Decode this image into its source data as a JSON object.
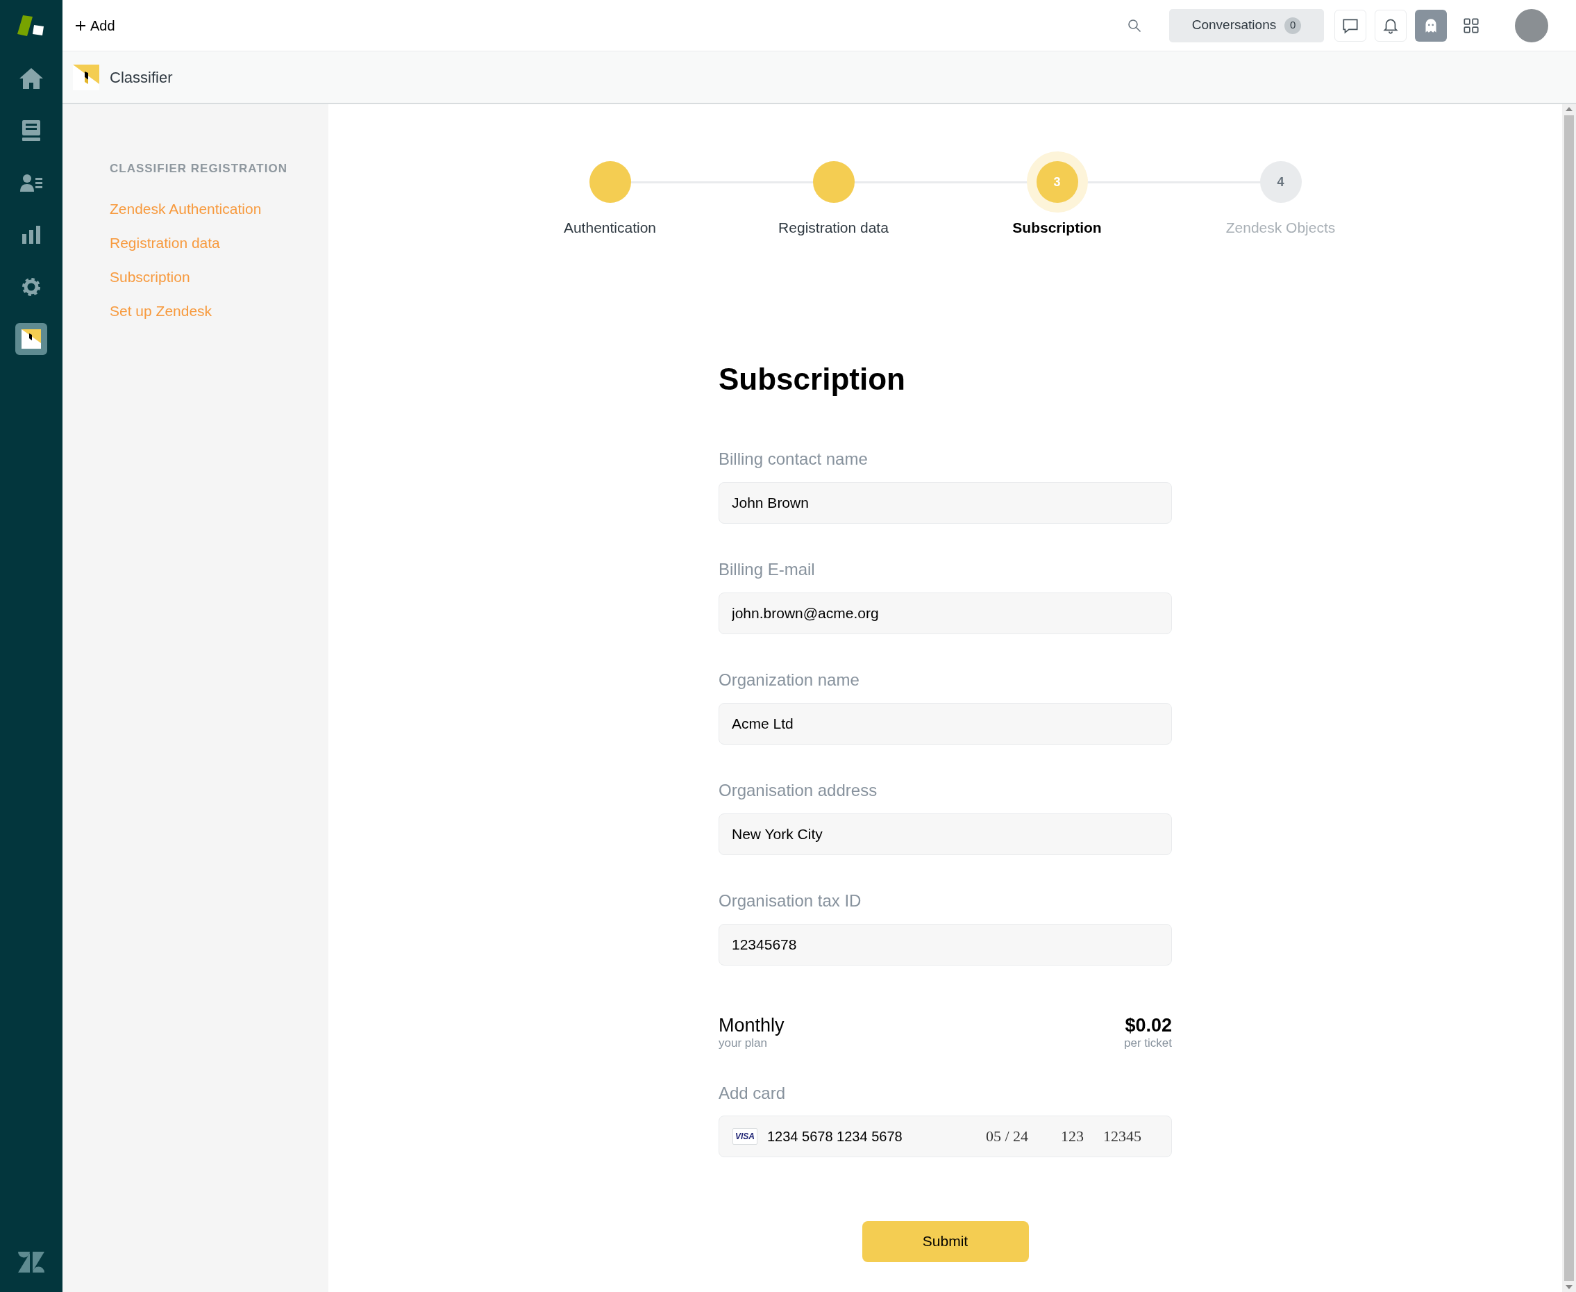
{
  "rail": {
    "items": [
      {
        "kind": "home",
        "selected": false
      },
      {
        "kind": "views",
        "selected": false
      },
      {
        "kind": "customers",
        "selected": false
      },
      {
        "kind": "reports",
        "selected": false
      },
      {
        "kind": "settings",
        "selected": false
      },
      {
        "kind": "classifier",
        "selected": true
      }
    ]
  },
  "top_bar": {
    "add": "Add",
    "conversations": {
      "label": "Conversations",
      "count": "0"
    },
    "icons": [
      {
        "kind": "chat",
        "selected": false
      },
      {
        "kind": "bell",
        "selected": false
      },
      {
        "kind": "ghost",
        "selected": true
      },
      {
        "kind": "grid",
        "selected": false
      }
    ]
  },
  "app_header": {
    "title": "Classifier"
  },
  "sidebar": {
    "heading": "CLASSIFIER REGISTRATION",
    "items": [
      "Zendesk Authentication",
      "Registration data",
      "Subscription",
      "Set up Zendesk"
    ]
  },
  "stepper": [
    {
      "label": "Authentication",
      "completed": true,
      "selected": false
    },
    {
      "label": "Registration data",
      "completed": true,
      "selected": false
    },
    {
      "number": "3",
      "label": "Subscription",
      "completed": false,
      "selected": true
    },
    {
      "number": "4",
      "label": "Zendesk Objects",
      "completed": false,
      "selected": false
    }
  ],
  "form": {
    "title": "Subscription",
    "fields": [
      {
        "label": "Billing contact name",
        "value": "John Brown"
      },
      {
        "label": "Billing E-mail",
        "value": "john.brown@acme.org"
      },
      {
        "label": "Organization name",
        "value": "Acme Ltd"
      },
      {
        "label": "Organisation address",
        "value": "New York City"
      },
      {
        "label": "Organisation tax ID",
        "value": "12345678"
      }
    ],
    "plan": {
      "name": "Monthly",
      "name_note": "your plan",
      "price": "$0.02",
      "price_note": "per ticket"
    },
    "card": {
      "label": "Add card",
      "brand": "VISA",
      "number": "1234 5678 1234 5678",
      "expiry": "05 / 24",
      "cvc": "123",
      "zip": "12345"
    },
    "submit": "Submit"
  }
}
